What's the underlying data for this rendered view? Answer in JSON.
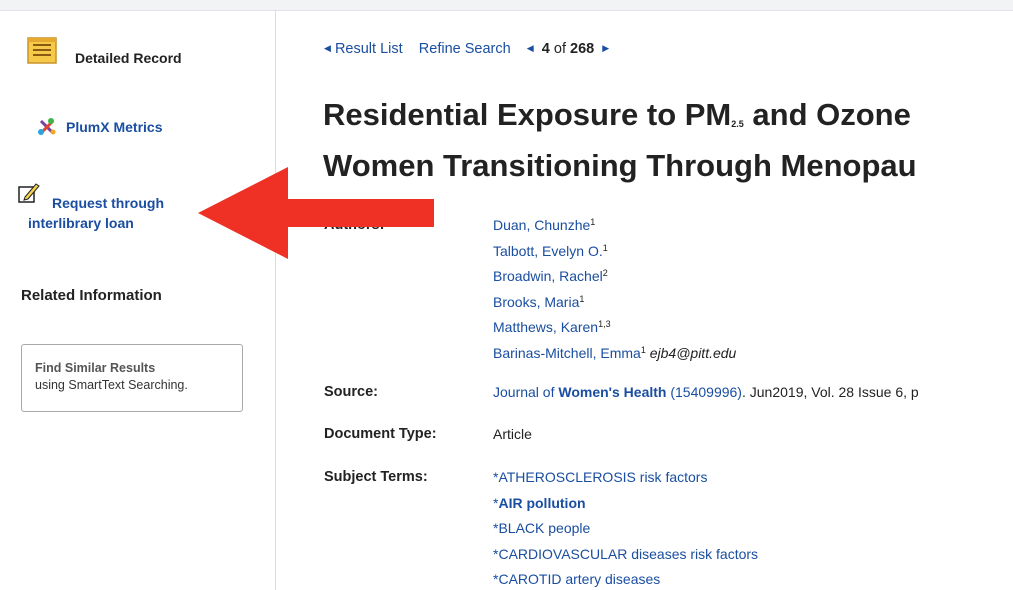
{
  "sidebar": {
    "detailed_record": "Detailed Record",
    "plumx": "PlumX Metrics",
    "ill_line1": "Request through",
    "ill_line2": "interlibrary loan",
    "related_info": "Related Information",
    "similar_title": "Find Similar Results",
    "similar_sub": "using SmartText Searching."
  },
  "nav": {
    "result_list": "Result List",
    "refine_search": "Refine Search",
    "current": "4",
    "of": "of",
    "total": "268"
  },
  "title": {
    "line1_pre": "Residential Exposure to PM",
    "line1_sub": "2.5",
    "line1_post": " and Ozone",
    "line2": "Women Transitioning Through Menopau"
  },
  "labels": {
    "authors": "Authors:",
    "source": "Source:",
    "doc_type": "Document Type:",
    "subject_terms": "Subject Terms:"
  },
  "authors": [
    {
      "name": "Duan, Chunzhe",
      "sup": "1"
    },
    {
      "name": "Talbott, Evelyn O.",
      "sup": "1"
    },
    {
      "name": "Broadwin, Rachel",
      "sup": "2"
    },
    {
      "name": "Brooks, Maria",
      "sup": "1"
    },
    {
      "name": "Matthews, Karen",
      "sup": "1,3"
    },
    {
      "name": "Barinas-Mitchell, Emma",
      "sup": "1",
      "email": "ejb4@pitt.edu"
    }
  ],
  "source": {
    "pre": "Journal of ",
    "bold": "Women's Health",
    "issn": " (15409996)",
    "rest": ". Jun2019, Vol. 28 Issue 6, p"
  },
  "doc_type": "Article",
  "subjects": [
    {
      "star": "*",
      "term": "ATHEROSCLEROSIS risk factors",
      "bold": false
    },
    {
      "star": "*",
      "term": "AIR pollution",
      "bold": true
    },
    {
      "star": "*",
      "term": "BLACK people",
      "bold": false
    },
    {
      "star": "*",
      "term": "CARDIOVASCULAR diseases risk factors",
      "bold": false
    },
    {
      "star": "*",
      "term": "CAROTID artery diseases",
      "bold": false
    }
  ],
  "colors": {
    "link": "#1a4ea0",
    "arrow": "#ee3124"
  }
}
